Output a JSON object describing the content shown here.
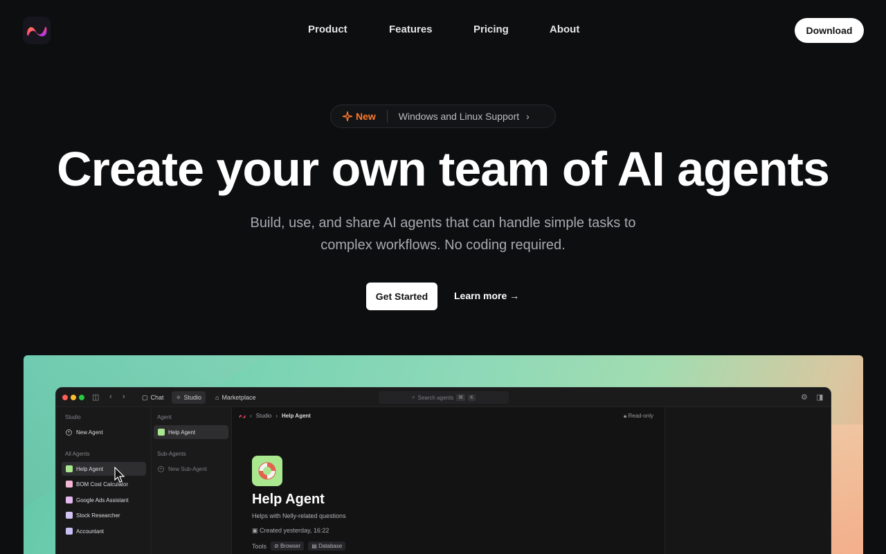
{
  "nav": {
    "logo_icon": "nelly-logo-icon",
    "links": [
      "Product",
      "Features",
      "Pricing",
      "About"
    ],
    "download_label": "Download"
  },
  "badge": {
    "tag": "New",
    "text": "Windows and Linux Support",
    "chevron": "›"
  },
  "hero": {
    "title": "Create your own team of AI agents",
    "subtitle_line1": "Build, use, and share AI agents that can handle simple tasks to",
    "subtitle_line2": "complex workflows. No coding required.",
    "primary_cta": "Get Started",
    "secondary_cta": "Learn more →"
  },
  "app": {
    "tabs": [
      "Chat",
      "Studio",
      "Marketplace"
    ],
    "active_tab": "Studio",
    "search_placeholder": "Search agents",
    "search_kbd1": "⌘",
    "search_kbd2": "K",
    "col1": {
      "section": "Studio",
      "new_agent": "New Agent",
      "all_agents": "All Agents",
      "agents": [
        {
          "label": "Help Agent",
          "color": "#a9e88e"
        },
        {
          "label": "BOM Cost Calculator",
          "color": "#f3b6d4"
        },
        {
          "label": "Google Ads Assistant",
          "color": "#e4b9f0"
        },
        {
          "label": "Stock Researcher",
          "color": "#d3c4f3"
        },
        {
          "label": "Accountant",
          "color": "#c8c0f5"
        }
      ]
    },
    "col2": {
      "section_agent": "Agent",
      "agent": "Help Agent",
      "section_sub": "Sub-Agents",
      "new_sub": "New Sub-Agent"
    },
    "breadcrumb": {
      "root": "Studio",
      "current": "Help Agent"
    },
    "read_only": "Read-only",
    "detail": {
      "title": "Help Agent",
      "description": "Helps with Nelly-related questions",
      "created": "Created yesterday, 16:22",
      "tools_label": "Tools",
      "tools": [
        "Browser",
        "Database"
      ]
    }
  },
  "colors": {
    "accent_new": "#ff7a2e",
    "page_bg": "#0d0e10"
  }
}
